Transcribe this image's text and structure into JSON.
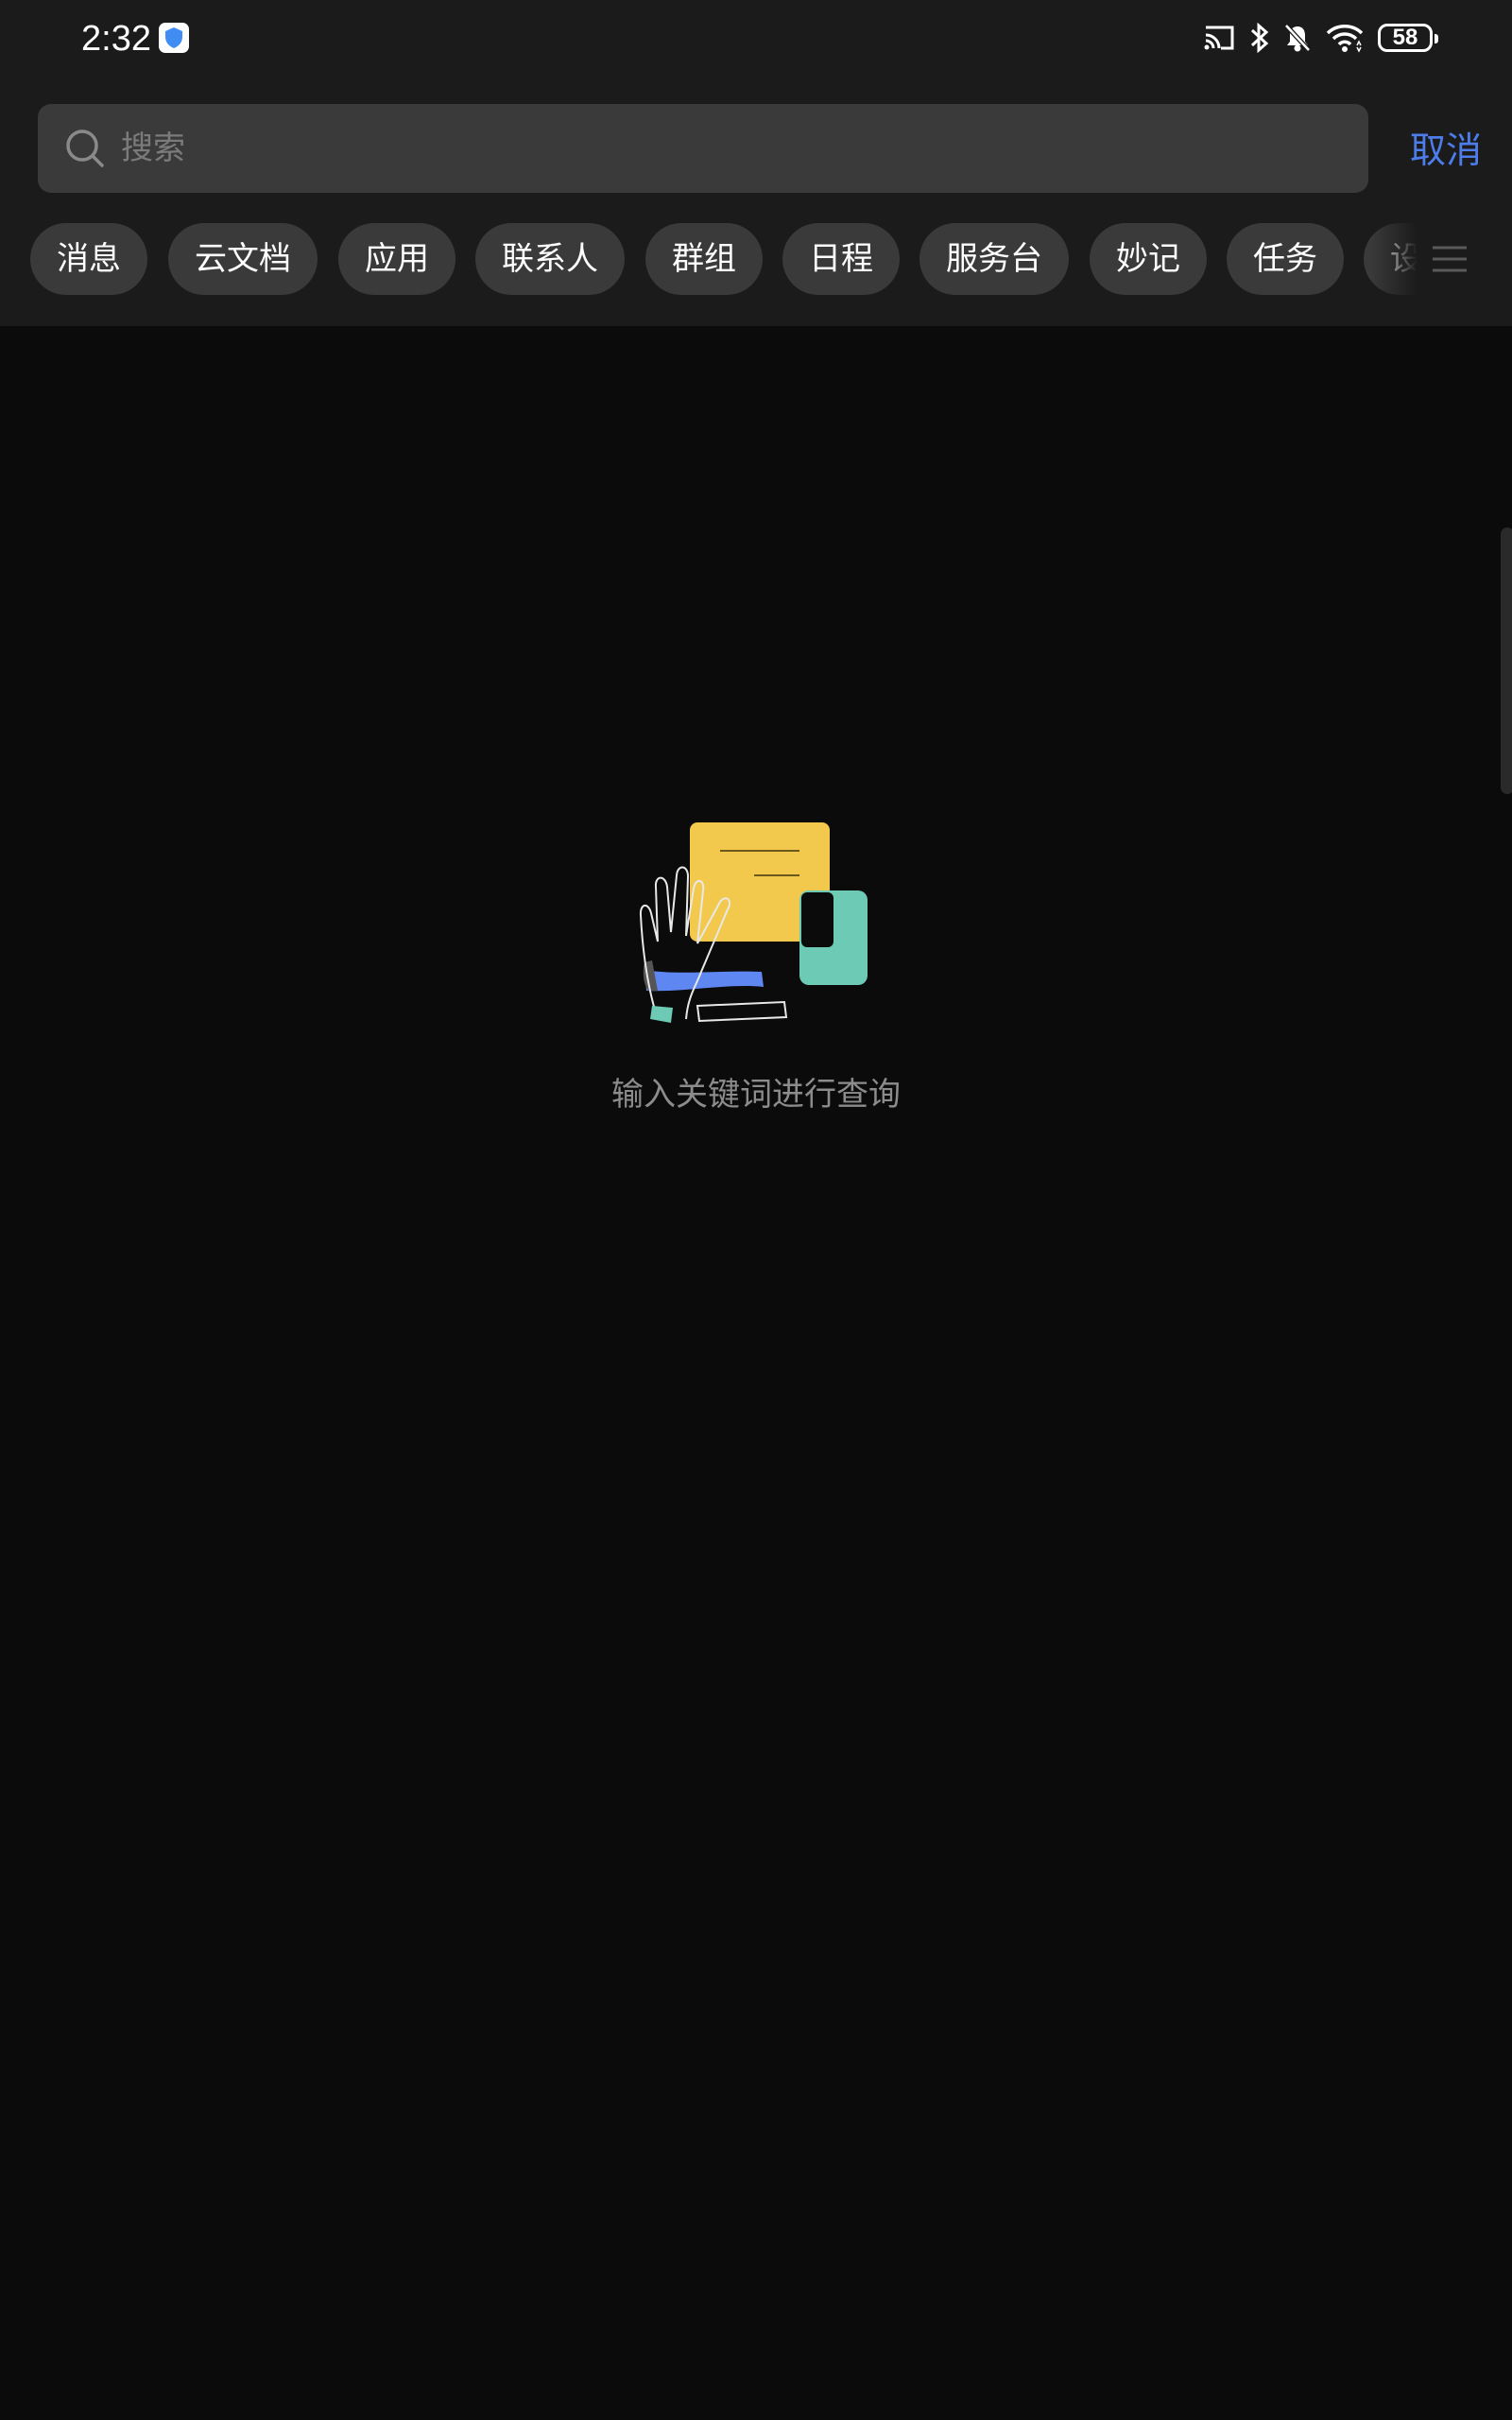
{
  "status_bar": {
    "time": "2:32",
    "battery": "58"
  },
  "search": {
    "placeholder": "搜索",
    "value": ""
  },
  "cancel_label": "取消",
  "categories": [
    "消息",
    "云文档",
    "应用",
    "联系人",
    "群组",
    "日程",
    "服务台",
    "妙记",
    "任务",
    "设置"
  ],
  "empty_state": {
    "message": "输入关键词进行查询"
  },
  "colors": {
    "accent": "#4d7dea",
    "header_bg": "#1b1b1b",
    "page_bg": "#0b0b0b",
    "chip_bg": "#3a3a3a"
  },
  "icons": {
    "status": [
      "shield-app-icon",
      "cast-icon",
      "bluetooth-icon",
      "mute-bell-icon",
      "wifi-icon",
      "battery-icon"
    ],
    "search": "search-icon",
    "menu": "hamburger-menu-icon"
  }
}
